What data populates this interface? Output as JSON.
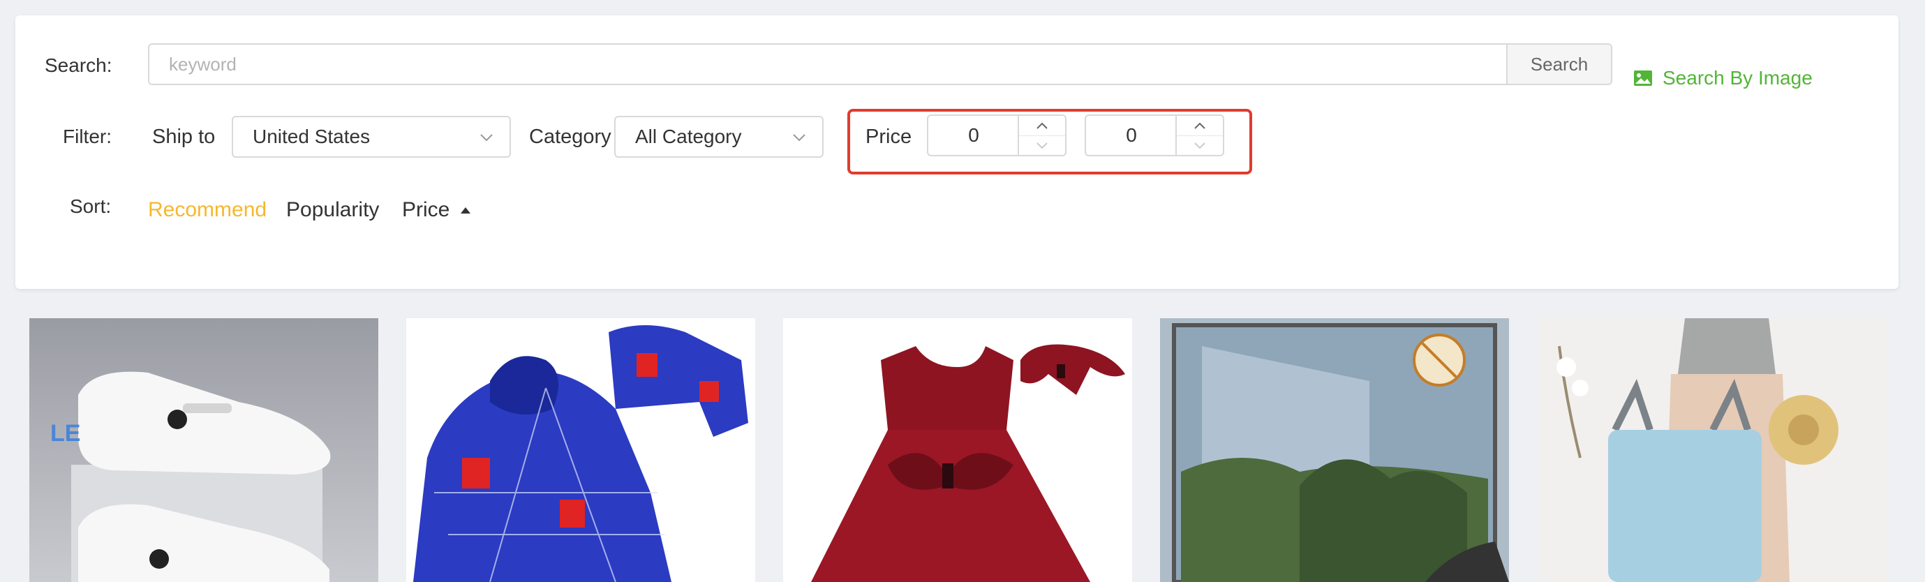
{
  "search": {
    "label": "Search:",
    "placeholder": "keyword",
    "button_label": "Search",
    "image_search_label": "Search By Image"
  },
  "filter": {
    "label": "Filter:",
    "ship_to_label": "Ship to",
    "ship_to_value": "United States",
    "category_label": "Category",
    "category_value": "All Category",
    "price_label": "Price",
    "price_min": "0",
    "price_separator": "-",
    "price_max": "0"
  },
  "sort": {
    "label": "Sort:",
    "options": [
      "Recommend",
      "Popularity",
      "Price"
    ],
    "active": "Recommend"
  },
  "products": [
    {
      "name": "white-clogs"
    },
    {
      "name": "spiderman-hoodie"
    },
    {
      "name": "red-bow-dress"
    },
    {
      "name": "window-screen"
    },
    {
      "name": "travel-bag"
    }
  ],
  "colors": {
    "accent_active": "#f5b82e",
    "image_search": "#52b536",
    "highlight_border": "#e03b2e"
  }
}
